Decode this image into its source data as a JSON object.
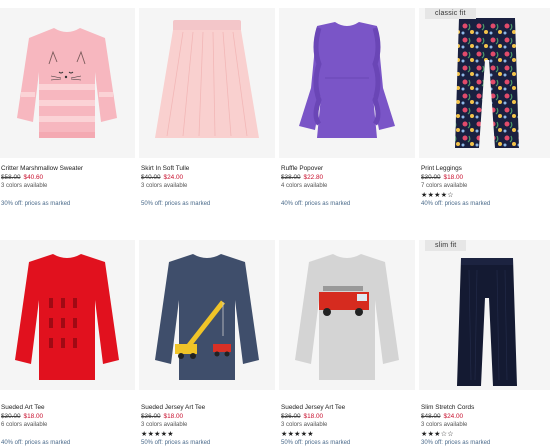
{
  "products": [
    {
      "name": "Critter Marshmallow Sweater",
      "old_price": "$58.00",
      "sale_price": "$40.60",
      "colors": "3 colors available",
      "promo": "30% off: prices as marked",
      "badge": "",
      "rating": ""
    },
    {
      "name": "Skirt In Soft Tulle",
      "old_price": "$40.00",
      "sale_price": "$24.00",
      "colors": "3 colors available",
      "promo": "50% off: prices as marked",
      "badge": "",
      "rating": ""
    },
    {
      "name": "Ruffle Popover",
      "old_price": "$38.00",
      "sale_price": "$22.80",
      "colors": "4 colors available",
      "promo": "40% off: prices as marked",
      "badge": "",
      "rating": ""
    },
    {
      "name": "Print Leggings",
      "old_price": "$30.00",
      "sale_price": "$18.00",
      "colors": "7 colors available",
      "promo": "40% off: prices as marked",
      "badge": "classic fit",
      "rating": "★★★★☆"
    },
    {
      "name": "Sueded Art Tee",
      "old_price": "$30.00",
      "sale_price": "$18.00",
      "colors": "6 colors available",
      "promo": "40% off: prices as marked",
      "badge": "",
      "rating": ""
    },
    {
      "name": "Sueded Jersey Art Tee",
      "old_price": "$36.00",
      "sale_price": "$18.00",
      "colors": "3 colors available",
      "promo": "50% off: prices as marked",
      "badge": "",
      "rating": "★★★★★"
    },
    {
      "name": "Sueded Jersey Art Tee",
      "old_price": "$36.00",
      "sale_price": "$18.00",
      "colors": "3 colors available",
      "promo": "50% off: prices as marked",
      "badge": "",
      "rating": "★★★★★"
    },
    {
      "name": "Slim Stretch Cords",
      "old_price": "$48.00",
      "sale_price": "$24.00",
      "colors": "3 colors available",
      "promo": "30% off: prices as marked",
      "badge": "slim fit",
      "rating": "★★★☆☆"
    }
  ],
  "colors": {
    "sale": "#c8102e",
    "promo": "#4a6a8a",
    "image_bg": "#f5f5f5"
  }
}
